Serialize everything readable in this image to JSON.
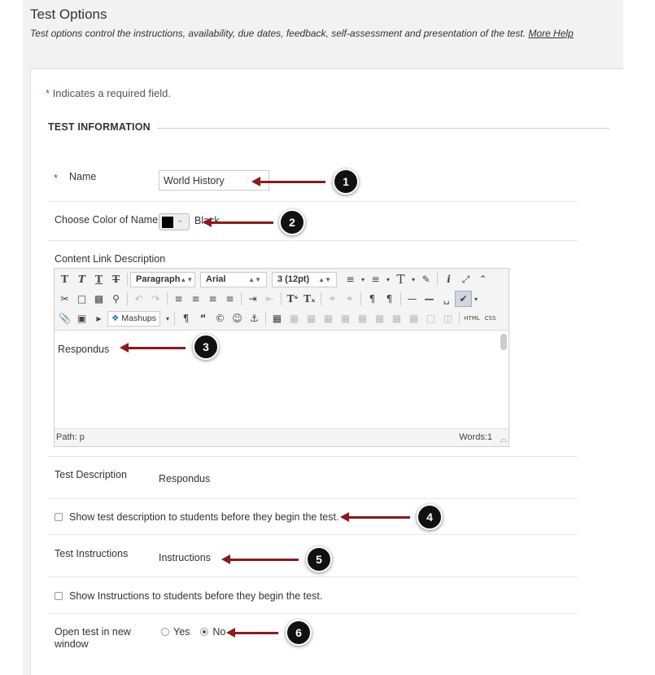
{
  "header": {
    "title": "Test Options",
    "subtitle": "Test options control the instructions, availability, due dates, feedback, self-assessment and presentation of the test.",
    "more_help": "More Help"
  },
  "required_note": {
    "star": "*",
    "text": "Indicates a required field."
  },
  "section": {
    "title": "TEST INFORMATION"
  },
  "fields": {
    "name": {
      "star": "*",
      "label": "Name",
      "value": "World History"
    },
    "color": {
      "label": "Choose Color of Name",
      "swatch": "#000000",
      "value": "Black"
    },
    "content_link": {
      "label": "Content Link Description"
    }
  },
  "editor": {
    "toolbar": {
      "row1": {
        "paragraph": "Paragraph",
        "font": "Arial",
        "size": "3 (12pt)"
      },
      "row3": {
        "mashups": "Mashups",
        "html": "HTML",
        "css": "CSS"
      }
    },
    "body_text": "Respondus",
    "status": {
      "path": "Path: p",
      "words": "Words:1"
    }
  },
  "test_description": {
    "label": "Test Description",
    "value": "Respondus"
  },
  "show_description": {
    "label": "Show test description to students before they begin the test.",
    "checked": false
  },
  "test_instructions": {
    "label": "Test Instructions",
    "value": "Instructions"
  },
  "show_instructions": {
    "label": "Show Instructions to students before they begin the test.",
    "checked": false
  },
  "open_new_window": {
    "label_line1": "Open test in new",
    "label_line2": "window",
    "options": [
      {
        "label": "Yes",
        "selected": false
      },
      {
        "label": "No",
        "selected": true
      }
    ]
  },
  "callouts": [
    "1",
    "2",
    "3",
    "4",
    "5",
    "6"
  ],
  "colors": {
    "arrow": "#8b1a1a",
    "callout_bg": "#111111",
    "required_star": "#c0392b"
  }
}
